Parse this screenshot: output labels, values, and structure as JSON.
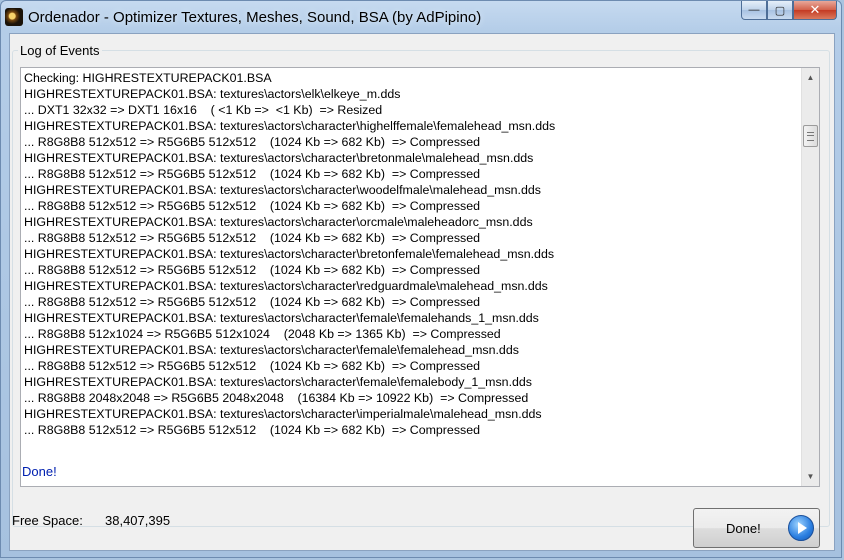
{
  "window": {
    "title": "Ordenador - Optimizer Textures, Meshes, Sound, BSA (by AdPipino)",
    "minimize_glyph": "—",
    "maximize_glyph": "▢",
    "close_glyph": "✕"
  },
  "group": {
    "label": "Log of Events"
  },
  "log": [
    "Checking: HIGHRESTEXTUREPACK01.BSA",
    "HIGHRESTEXTUREPACK01.BSA: textures\\actors\\elk\\elkeye_m.dds",
    "... DXT1 32x32 => DXT1 16x16    ( <1 Kb =>  <1 Kb)  => Resized",
    "HIGHRESTEXTUREPACK01.BSA: textures\\actors\\character\\highelffemale\\femalehead_msn.dds",
    "... R8G8B8 512x512 => R5G6B5 512x512    (1024 Kb => 682 Kb)  => Compressed",
    "HIGHRESTEXTUREPACK01.BSA: textures\\actors\\character\\bretonmale\\malehead_msn.dds",
    "... R8G8B8 512x512 => R5G6B5 512x512    (1024 Kb => 682 Kb)  => Compressed",
    "HIGHRESTEXTUREPACK01.BSA: textures\\actors\\character\\woodelfmale\\malehead_msn.dds",
    "... R8G8B8 512x512 => R5G6B5 512x512    (1024 Kb => 682 Kb)  => Compressed",
    "HIGHRESTEXTUREPACK01.BSA: textures\\actors\\character\\orcmale\\maleheadorc_msn.dds",
    "... R8G8B8 512x512 => R5G6B5 512x512    (1024 Kb => 682 Kb)  => Compressed",
    "HIGHRESTEXTUREPACK01.BSA: textures\\actors\\character\\bretonfemale\\femalehead_msn.dds",
    "... R8G8B8 512x512 => R5G6B5 512x512    (1024 Kb => 682 Kb)  => Compressed",
    "HIGHRESTEXTUREPACK01.BSA: textures\\actors\\character\\redguardmale\\malehead_msn.dds",
    "... R8G8B8 512x512 => R5G6B5 512x512    (1024 Kb => 682 Kb)  => Compressed",
    "HIGHRESTEXTUREPACK01.BSA: textures\\actors\\character\\female\\femalehands_1_msn.dds",
    "... R8G8B8 512x1024 => R5G6B5 512x1024    (2048 Kb => 1365 Kb)  => Compressed",
    "HIGHRESTEXTUREPACK01.BSA: textures\\actors\\character\\female\\femalehead_msn.dds",
    "... R8G8B8 512x512 => R5G6B5 512x512    (1024 Kb => 682 Kb)  => Compressed",
    "HIGHRESTEXTUREPACK01.BSA: textures\\actors\\character\\female\\femalebody_1_msn.dds",
    "... R8G8B8 2048x2048 => R5G6B5 2048x2048    (16384 Kb => 10922 Kb)  => Compressed",
    "HIGHRESTEXTUREPACK01.BSA: textures\\actors\\character\\imperialmale\\malehead_msn.dds",
    "... R8G8B8 512x512 => R5G6B5 512x512    (1024 Kb => 682 Kb)  => Compressed"
  ],
  "status_text": "Done!",
  "free_space": {
    "label": "Free Space:",
    "value": "38,407,395"
  },
  "done_button": {
    "label": "Done!"
  },
  "colors": {
    "status_text": "#0020b0",
    "accent": "#2a7ee0"
  }
}
